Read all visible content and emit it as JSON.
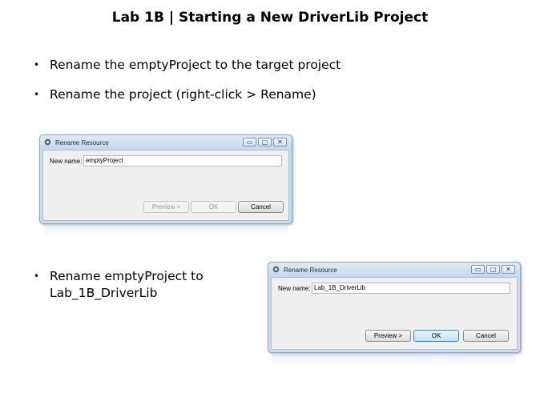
{
  "slide": {
    "title": "Lab 1B | Starting a New DriverLib Project",
    "bullets": [
      "Rename the emptyProject to the target project",
      "Rename the project (right-click > Rename)",
      "Rename emptyProject to",
      "Lab_1B_DriverLib"
    ],
    "bullet_glyph": "•"
  },
  "dialog_before": {
    "title": "Rename Resource",
    "new_name_label": "New name:",
    "new_name_value": "emptyProject",
    "preview_label": "Preview >",
    "ok_label": "OK",
    "cancel_label": "Cancel"
  },
  "dialog_after": {
    "title": "Rename Resource",
    "new_name_label": "New name:",
    "new_name_value": "Lab_1B_DriverLib",
    "preview_label": "Preview >",
    "ok_label": "OK",
    "cancel_label": "Cancel"
  },
  "window_controls": {
    "minimize": "▭",
    "maximize": "□",
    "close": "✕"
  },
  "colors": {
    "frame": "#c7dcf1",
    "accent": "#3c7fb1"
  }
}
